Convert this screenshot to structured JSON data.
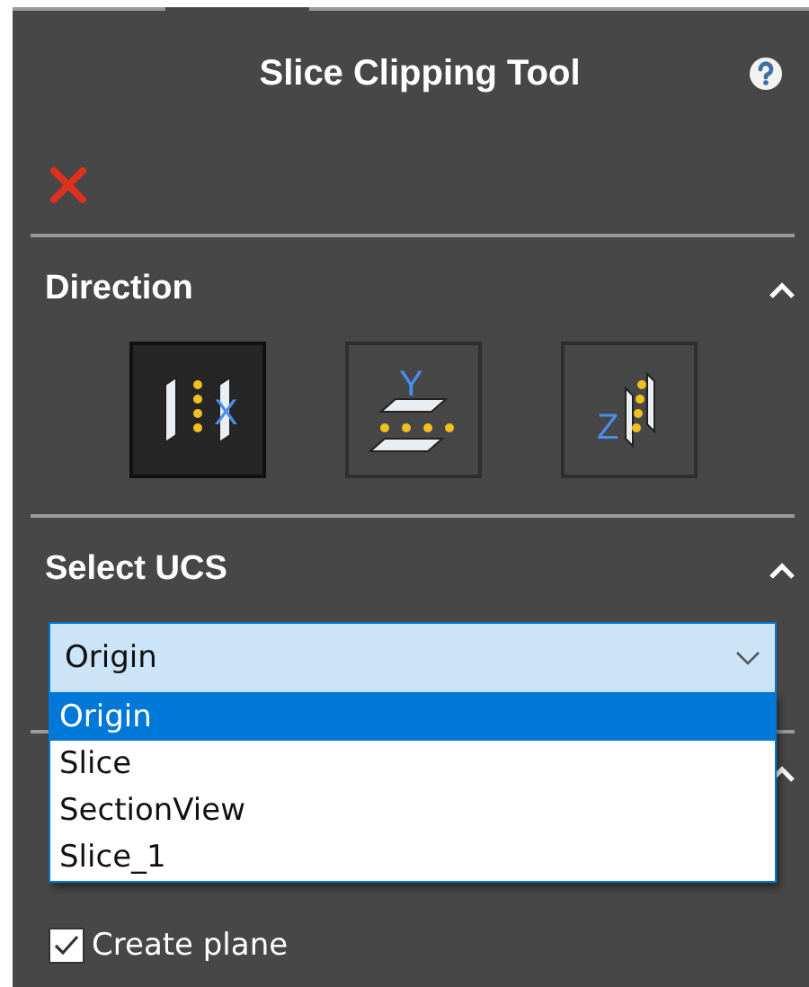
{
  "title": "Slice Clipping Tool",
  "sections": [
    {
      "title": "Direction",
      "expanded": true
    },
    {
      "title": "Select UCS",
      "expanded": true
    }
  ],
  "directions": [
    {
      "kind": "x",
      "label": "X",
      "selected": true
    },
    {
      "kind": "y",
      "label": "Y",
      "selected": false
    },
    {
      "kind": "z",
      "label": "Z",
      "selected": false
    }
  ],
  "ucs_dropdown": {
    "value": "Origin",
    "open": true,
    "options": [
      {
        "label": "Origin",
        "selected": true
      },
      {
        "label": "Slice",
        "selected": false
      },
      {
        "label": "SectionView",
        "selected": false
      },
      {
        "label": "Slice_1",
        "selected": false
      }
    ]
  },
  "hidden_section": {
    "expanded": true
  },
  "create_plane": {
    "label": "Create plane",
    "checked": true
  }
}
